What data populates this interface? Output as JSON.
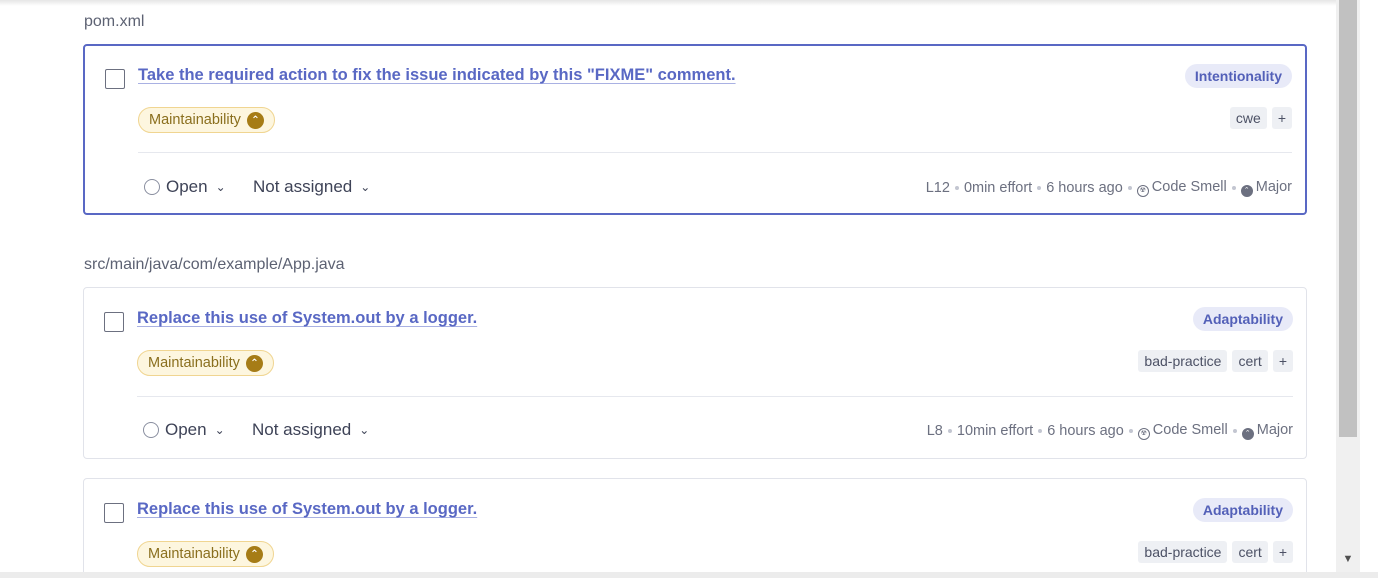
{
  "files": [
    {
      "path": "pom.xml",
      "issues": [
        {
          "title": "Take the required action to fix the issue indicated by this \"FIXME\" comment.",
          "attribute": "Intentionality",
          "quality": "Maintainability",
          "tags": [
            "cwe",
            "+"
          ],
          "status": "Open",
          "assignee": "Not assigned",
          "line": "L12",
          "effort": "0min effort",
          "age": "6 hours ago",
          "type": "Code Smell",
          "severity": "Major"
        }
      ]
    },
    {
      "path": "src/main/java/com/example/App.java",
      "issues": [
        {
          "title": "Replace this use of System.out by a logger.",
          "attribute": "Adaptability",
          "quality": "Maintainability",
          "tags": [
            "bad-practice",
            "cert",
            "+"
          ],
          "status": "Open",
          "assignee": "Not assigned",
          "line": "L8",
          "effort": "10min effort",
          "age": "6 hours ago",
          "type": "Code Smell",
          "severity": "Major"
        },
        {
          "title": "Replace this use of System.out by a logger.",
          "attribute": "Adaptability",
          "quality": "Maintainability",
          "tags": [
            "bad-practice",
            "cert",
            "+"
          ]
        }
      ]
    }
  ],
  "icons": {
    "severity": "chevron-up-circle-icon",
    "type": "code-smell-icon",
    "status": "open-circle-icon",
    "dropdown": "chevron-down-icon"
  },
  "colors": {
    "accent": "#5968c4",
    "quality_badge_bg": "#fdf6df",
    "quality_badge_text": "#8a6f1e",
    "attribute_badge_bg": "#e8eaf8"
  }
}
